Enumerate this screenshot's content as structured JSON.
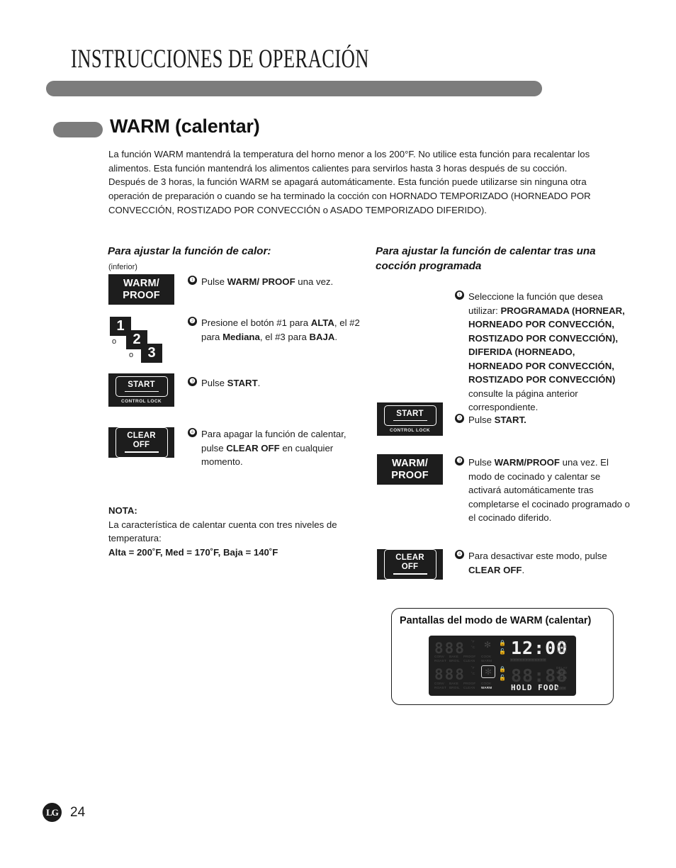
{
  "header": {
    "title": "INSTRUCCIONES DE OPERACIÓN"
  },
  "section": {
    "title": "WARM (calentar)"
  },
  "intro": {
    "p1": "La función WARM mantendrá la temperatura del horno menor a los 200°F. No utilice esta función para recalentar los alimentos. Esta función mantendrá los alimentos calientes para servirlos hasta 3 horas después de su cocción.",
    "p2": "Después de 3 horas, la función WARM se apagará automáticamente. Esta función puede utilizarse sin ninguna otra operación de preparación o cuando se ha terminado la cocción con HORNADO TEMPORIZADO (HORNEADO POR CONVECCIÓN, ROSTIZADO POR CONVECCIÓN o ASADO TEMPORIZADO  DIFERIDO)."
  },
  "left_column": {
    "heading": "Para ajustar la función de calor:",
    "sublabel": "(inferior)",
    "keys": {
      "warm_proof_line1": "WARM/",
      "warm_proof_line2": "PROOF",
      "num1": "1",
      "num2": "2",
      "num3": "3",
      "or1": "o",
      "or2": "o",
      "start_label": "START",
      "start_sub": "CONTROL LOCK",
      "clear_line1": "CLEAR",
      "clear_line2": "OFF"
    },
    "steps": [
      {
        "num": "❶",
        "html": "Pulse <b>WARM/ PROOF</b> una vez."
      },
      {
        "num": "❷",
        "html": "Presione el botón #1 para <b>ALTA</b>, el #2 para <b>Mediana</b>, el #3 para <b>BAJA</b>."
      },
      {
        "num": "❸",
        "html": "Pulse <b>START</b>."
      },
      {
        "num": "❹",
        "html": "Para apagar la función de calentar, pulse <b>CLEAR OFF</b> en cualquier momento."
      }
    ]
  },
  "nota": {
    "title": "NOTA:",
    "body": "La característica de calentar cuenta con tres niveles de temperatura:",
    "levels": "Alta = 200˚F, Med = 170˚F, Baja = 140˚F"
  },
  "right_column": {
    "heading": "Para ajustar la función de calentar tras una cocción programada",
    "keys": {
      "start_label": "START",
      "start_sub": "CONTROL LOCK",
      "warm_proof_line1": "WARM/",
      "warm_proof_line2": "PROOF",
      "clear_line1": "CLEAR",
      "clear_line2": "OFF"
    },
    "steps": [
      {
        "num": "❶",
        "html": "Seleccione la función que desea utilizar: <b>PROGRAMADA (HORNEAR, HORNEADO POR CONVECCIÓN, ROSTIZADO POR CONVECCIÓN), DIFERIDA (HORNEADO, HORNEADO POR CONVECCIÓN, ROSTIZADO POR CONVECCIÓN)</b> consulte la página anterior correspondiente."
      },
      {
        "num": "❷",
        "html": "Pulse <b>START.</b>"
      },
      {
        "num": "❸",
        "html": "Pulse <b>WARM/PROOF</b> una vez. El modo de cocinado y calentar se activará automáticamente tras completarse el cocinado programado o el cocinado diferido."
      },
      {
        "num": "❹",
        "html": "Para desactivar este modo, pulse <b>CLEAR OFF</b>."
      }
    ]
  },
  "display_panel": {
    "title": "Pantallas del modo de WARM (calentar)",
    "lcd": {
      "upper_digits": "888",
      "lower_digits": "888",
      "clock_value": "12:00",
      "lower_clock_value": "88:88",
      "status_text": "HOLD FOOD",
      "labels_upper_row1": "CONV   BAKE   PROOF   COOK",
      "labels_upper_row2": "ROAST  BROIL  CLEAN  WARM",
      "labels_lower_row1": "CONV   BAKE   PROOF   COOK",
      "labels_lower_row2": "ROAST  BROIL  CLEAN  WARM",
      "upper_label_conv": "CONV",
      "upper_label_roast": "ROAST",
      "upper_label_bake": "BAKE",
      "upper_label_broil": "BROIL",
      "upper_label_proof": "PROOF",
      "upper_label_clean": "CLEAN",
      "upper_label_cook": "COOK",
      "upper_label_warm": "WARM",
      "right_labels_1": "DELAY",
      "right_labels_2": "TIMED",
      "right_labels_3": "TIMER",
      "right_labels_4": "DELAY",
      "right_labels_5": "TIMED",
      "right_labels_6": "TIMER",
      "degree_f": "˚F",
      "degree_c": "˚C"
    }
  },
  "footer": {
    "logo": "LG",
    "page_number": "24"
  }
}
